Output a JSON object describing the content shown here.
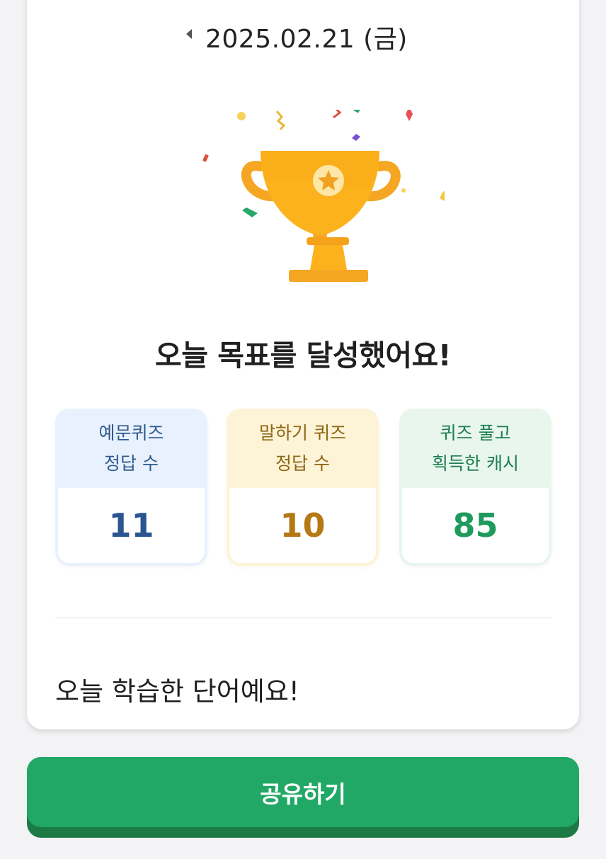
{
  "header": {
    "date": "2025.02.21 (금)"
  },
  "result": {
    "headline": "오늘 목표를 달성했어요!"
  },
  "stats": [
    {
      "label": "예문퀴즈\n정답 수",
      "value": "11"
    },
    {
      "label": "말하기 퀴즈\n정답 수",
      "value": "10"
    },
    {
      "label": "퀴즈 풀고\n획득한 캐시",
      "value": "85"
    }
  ],
  "words": {
    "title": "오늘 학습한 단어예요!"
  },
  "footer": {
    "share_label": "공유하기"
  },
  "colors": {
    "accent_green": "#21a866",
    "trophy_gold": "#fbb21c",
    "stat_blue": "#2a5590",
    "stat_orange": "#b57913",
    "stat_green": "#1f9a5d"
  },
  "icons": {
    "prev": "caret-left-icon",
    "trophy": "trophy-icon",
    "confetti": "confetti-icon"
  }
}
